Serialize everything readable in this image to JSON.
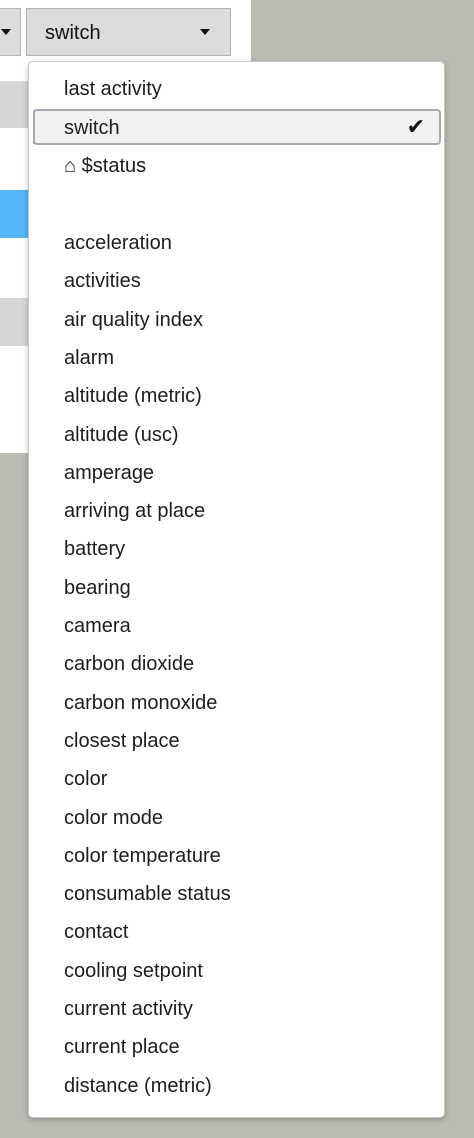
{
  "selector": {
    "selected_value": "switch"
  },
  "dropdown": {
    "pinned": [
      "last activity",
      "switch",
      "⌂ $status"
    ],
    "selected": "switch",
    "check_glyph": "✔",
    "attributes": [
      "acceleration",
      "activities",
      "air quality index",
      "alarm",
      "altitude (metric)",
      "altitude (usc)",
      "amperage",
      "arriving at place",
      "battery",
      "bearing",
      "camera",
      "carbon dioxide",
      "carbon monoxide",
      "closest place",
      "color",
      "color mode",
      "color temperature",
      "consumable status",
      "contact",
      "cooling setpoint",
      "current activity",
      "current place",
      "distance (metric)"
    ]
  },
  "colors": {
    "background": "#bcbcb5",
    "accent_blue": "#55b6f7",
    "select_bg": "#dcdcde"
  },
  "icons": {
    "caret": "chevron-down-icon",
    "check": "checkmark-icon",
    "home": "home-icon"
  }
}
